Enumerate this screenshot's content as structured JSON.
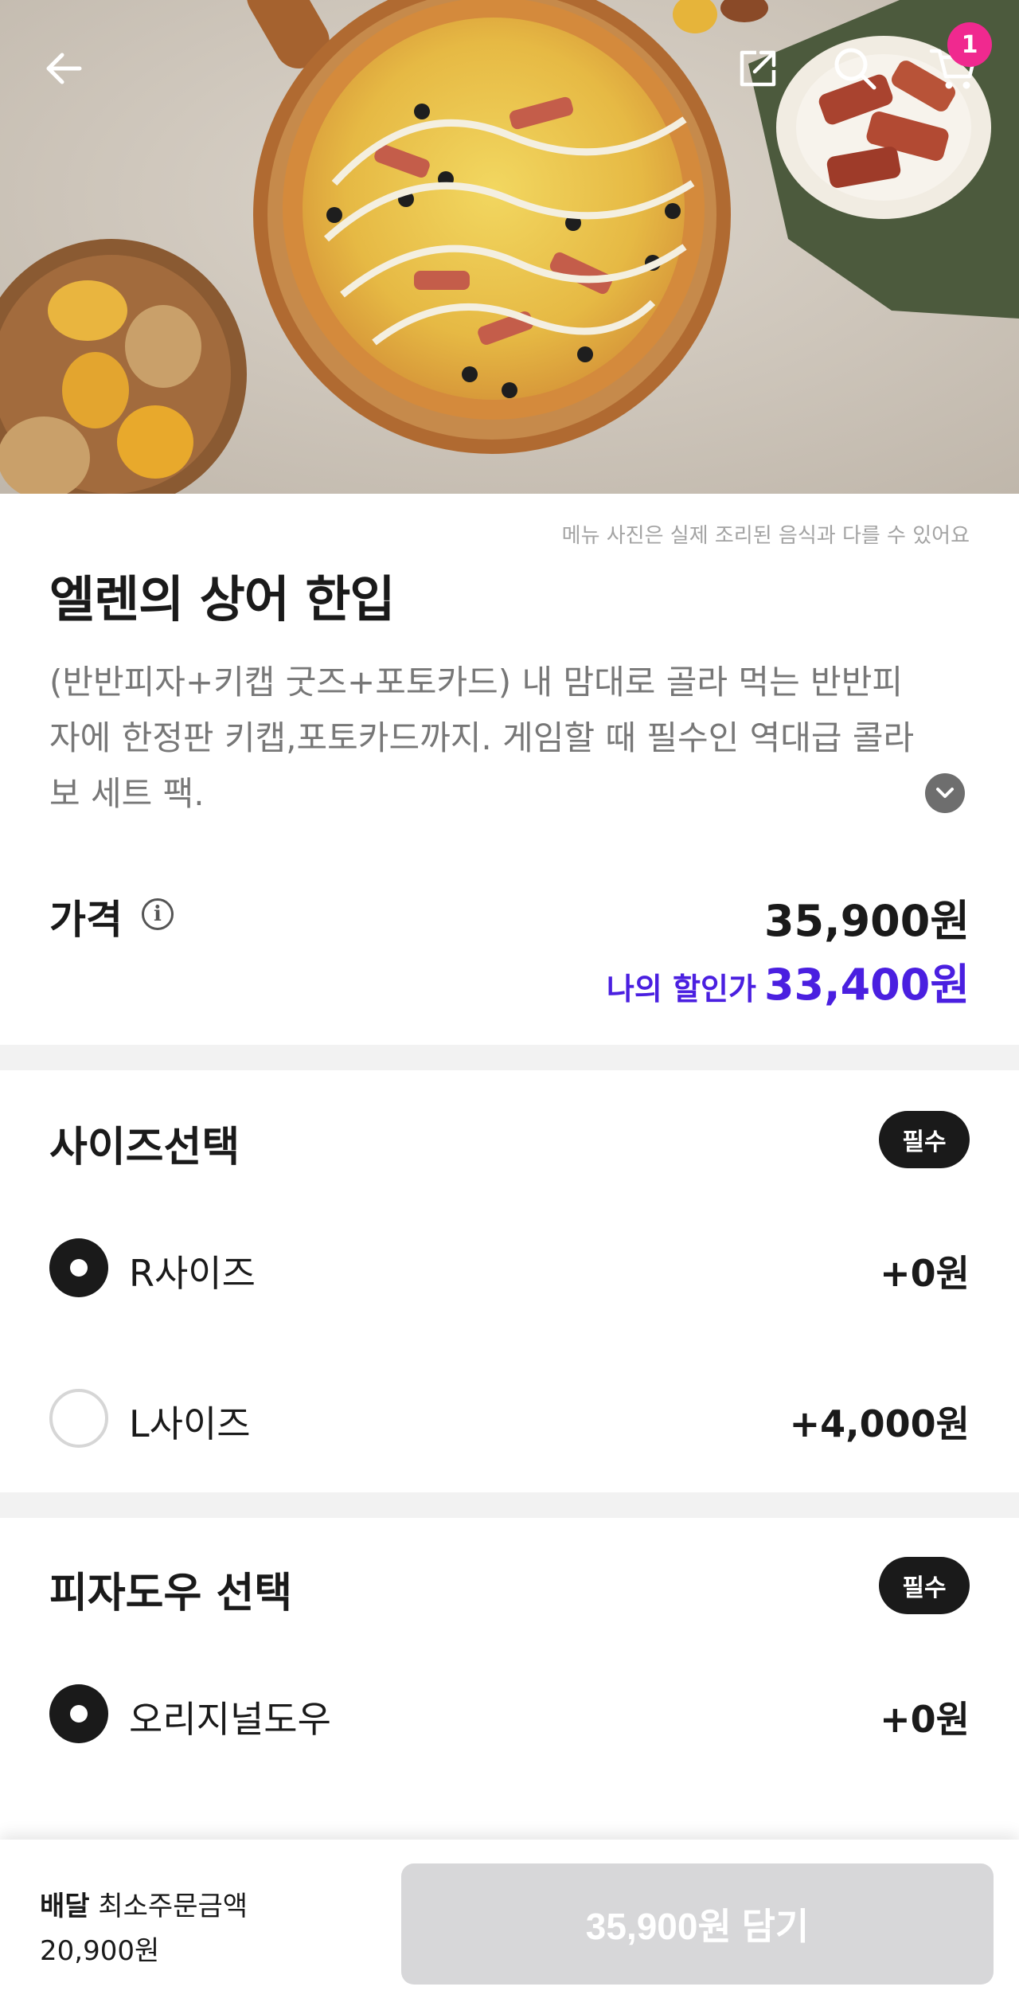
{
  "header": {
    "back_icon": "arrow-left-icon",
    "share_icon": "share-external-icon",
    "search_icon": "search-icon",
    "cart_icon": "cart-icon",
    "cart_count": "1",
    "badge_color": "#f0298f"
  },
  "menu": {
    "photo_note": "메뉴 사진은 실제 조리된 음식과 다를 수 있어요",
    "title": "엘렌의 상어 한입",
    "description": "(반반피자+키캡 굿즈+포토카드) 내 맘대로 골라 먹는 반반피자에 한정판 키캡,포토카드까지. 게임할 때 필수인 역대급 콜라보 세트 팩.",
    "expand_icon": "chevron-down-icon"
  },
  "price": {
    "label": "가격",
    "info_icon": "info-icon",
    "info_glyph": "i",
    "value": "35,900원",
    "discount_label": "나의 할인가",
    "discount_value": "33,400원",
    "discount_color": "#4a1fe0"
  },
  "size_section": {
    "title": "사이즈선택",
    "badge": "필수",
    "options": [
      {
        "label": "R사이즈",
        "price": "+0원",
        "selected": true
      },
      {
        "label": "L사이즈",
        "price": "+4,000원",
        "selected": false
      }
    ]
  },
  "dough_section": {
    "title": "피자도우 선택",
    "badge": "필수",
    "options": [
      {
        "label": "오리지널도우",
        "price": "+0원",
        "selected": true
      }
    ]
  },
  "bottom_bar": {
    "delivery_label": "배달",
    "min_order_label": "최소주문금액",
    "min_order_amount": "20,900원",
    "add_button_label": "35,900원 담기"
  }
}
